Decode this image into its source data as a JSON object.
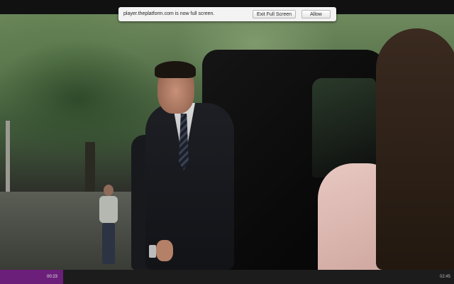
{
  "notification": {
    "message": "player.theplatform.com is now full screen.",
    "exit_label": "Exit Full Screen",
    "allow_label": "Allow"
  },
  "player": {
    "current_time": "00:23",
    "duration": "02:45",
    "progress_fraction": 0.139,
    "accent_color": "#6b1e7a"
  }
}
